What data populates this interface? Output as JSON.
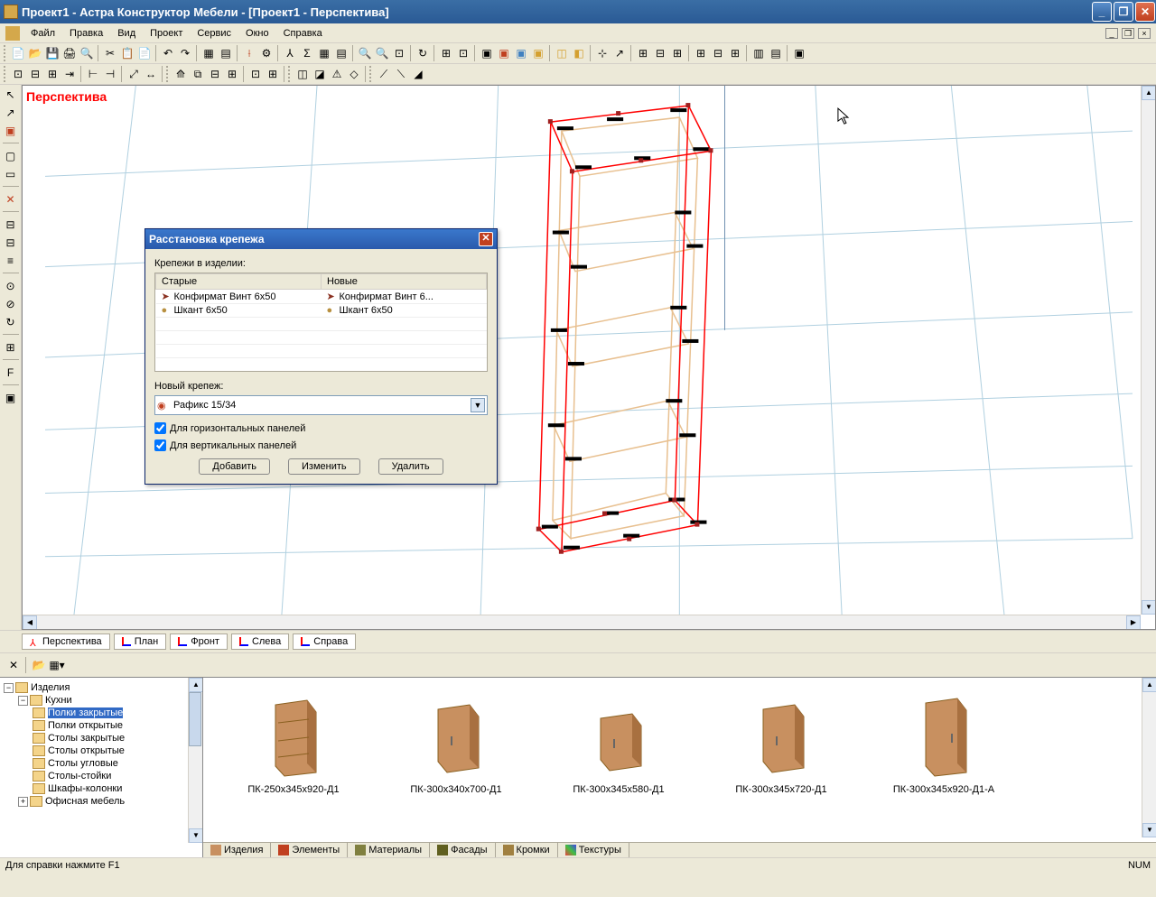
{
  "title": "Проект1 - Астра Конструктор Мебели - [Проект1 - Перспектива]",
  "menu": {
    "file": "Файл",
    "edit": "Правка",
    "view": "Вид",
    "project": "Проект",
    "service": "Сервис",
    "window": "Окно",
    "help": "Справка"
  },
  "viewport": {
    "title": "Перспектива"
  },
  "dialog": {
    "title": "Расстановка крепежа",
    "label_fasteners": "Крепежи в изделии:",
    "col_old": "Старые",
    "col_new": "Новые",
    "rows": [
      {
        "old": "Конфирмат Винт 6х50",
        "new": "Конфирмат Винт 6..."
      },
      {
        "old": "Шкант 6х50",
        "new": "Шкант 6х50"
      }
    ],
    "label_new": "Новый крепеж:",
    "select_value": "Рафикс 15/34",
    "check_h": "Для горизонтальных панелей",
    "check_v": "Для вертикальных панелей",
    "btn_add": "Добавить",
    "btn_change": "Изменить",
    "btn_delete": "Удалить"
  },
  "view_tabs": {
    "perspective": "Перспектива",
    "plan": "План",
    "front": "Фронт",
    "left": "Слева",
    "right": "Справа"
  },
  "tree": {
    "root": "Изделия",
    "kitchen": "Кухни",
    "items": [
      "Полки закрытые",
      "Полки открытые",
      "Столы закрытые",
      "Столы открытые",
      "Столы угловые",
      "Столы-стойки",
      "Шкафы-колонки"
    ],
    "office": "Офисная мебель"
  },
  "catalog": {
    "items": [
      "ПК-250х345х920-Д1",
      "ПК-300х340х700-Д1",
      "ПК-300х345х580-Д1",
      "ПК-300х345х720-Д1",
      "ПК-300х345х920-Д1-А"
    ],
    "tabs": {
      "products": "Изделия",
      "elements": "Элементы",
      "materials": "Материалы",
      "facades": "Фасады",
      "edges": "Кромки",
      "textures": "Текстуры"
    }
  },
  "statusbar": {
    "help": "Для справки нажмите F1",
    "num": "NUM"
  }
}
